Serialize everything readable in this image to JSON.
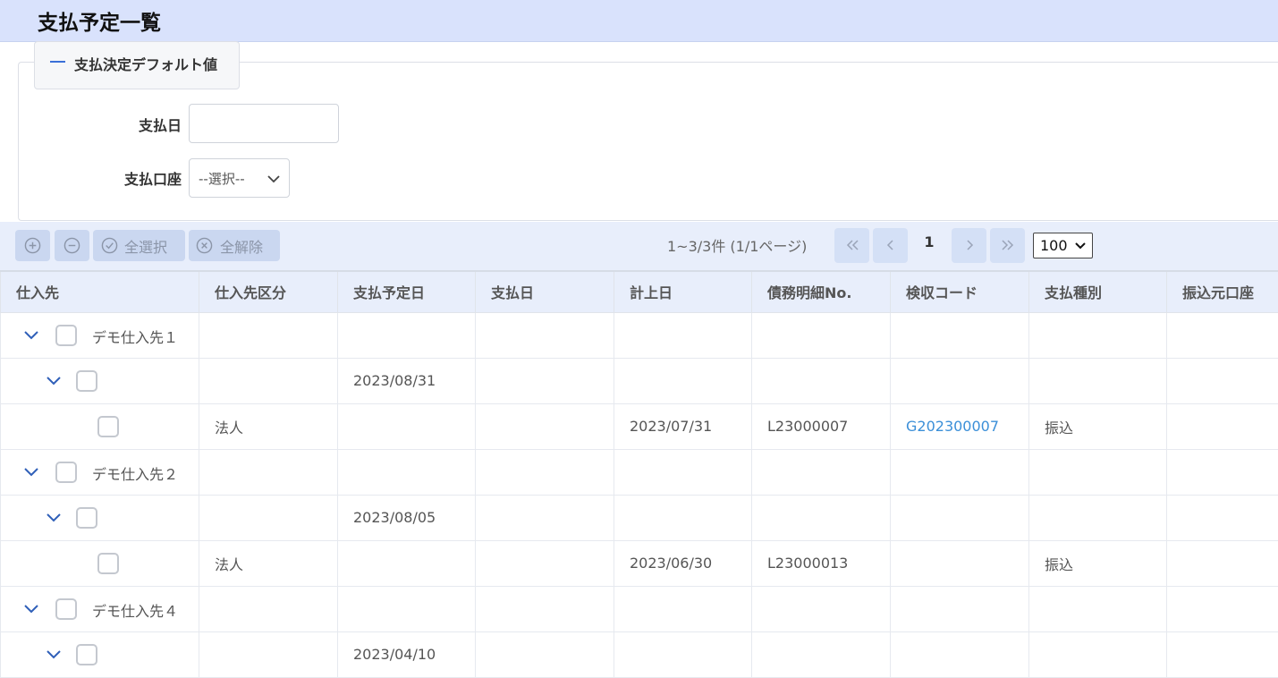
{
  "page_title": "支払予定一覧",
  "section": {
    "title": "支払決定デフォルト値"
  },
  "form": {
    "pay_date_label": "支払日",
    "pay_date_value": "",
    "account_label": "支払口座",
    "account_selected": "--選択--"
  },
  "toolbar": {
    "select_all": "全選択",
    "clear_all": "全解除",
    "range_text": "1~3/3件 (1/1ページ)",
    "current_page": "1",
    "per_page": "100"
  },
  "table": {
    "columns": [
      "仕入先",
      "仕入先区分",
      "支払予定日",
      "支払日",
      "計上日",
      "債務明細No.",
      "検収コード",
      "支払種別",
      "振込元口座"
    ],
    "rows": [
      {
        "level": 0,
        "supplier": "デモ仕入先１",
        "category": "",
        "scheduled": "",
        "pay_date": "",
        "post_date": "",
        "debt_no": "",
        "inspection": "",
        "pay_type": "",
        "account": ""
      },
      {
        "level": 1,
        "supplier": "",
        "category": "",
        "scheduled": "2023/08/31",
        "pay_date": "",
        "post_date": "",
        "debt_no": "",
        "inspection": "",
        "pay_type": "",
        "account": ""
      },
      {
        "level": 2,
        "supplier": "",
        "category": "法人",
        "scheduled": "",
        "pay_date": "",
        "post_date": "2023/07/31",
        "debt_no": "L23000007",
        "inspection": "G202300007",
        "pay_type": "振込",
        "account": ""
      },
      {
        "level": 0,
        "supplier": "デモ仕入先２",
        "category": "",
        "scheduled": "",
        "pay_date": "",
        "post_date": "",
        "debt_no": "",
        "inspection": "",
        "pay_type": "",
        "account": ""
      },
      {
        "level": 1,
        "supplier": "",
        "category": "",
        "scheduled": "2023/08/05",
        "pay_date": "",
        "post_date": "",
        "debt_no": "",
        "inspection": "",
        "pay_type": "",
        "account": ""
      },
      {
        "level": 2,
        "supplier": "",
        "category": "法人",
        "scheduled": "",
        "pay_date": "",
        "post_date": "2023/06/30",
        "debt_no": "L23000013",
        "inspection": "",
        "pay_type": "振込",
        "account": ""
      },
      {
        "level": 0,
        "supplier": "デモ仕入先４",
        "category": "",
        "scheduled": "",
        "pay_date": "",
        "post_date": "",
        "debt_no": "",
        "inspection": "",
        "pay_type": "",
        "account": ""
      },
      {
        "level": 1,
        "supplier": "",
        "category": "",
        "scheduled": "2023/04/10",
        "pay_date": "",
        "post_date": "",
        "debt_no": "",
        "inspection": "",
        "pay_type": "",
        "account": ""
      }
    ]
  },
  "colors": {
    "header_bg": "#d9e2fc",
    "toolbar_bg": "#e8eefb",
    "link": "#3b8fd8",
    "accent": "#3a6fd8"
  }
}
